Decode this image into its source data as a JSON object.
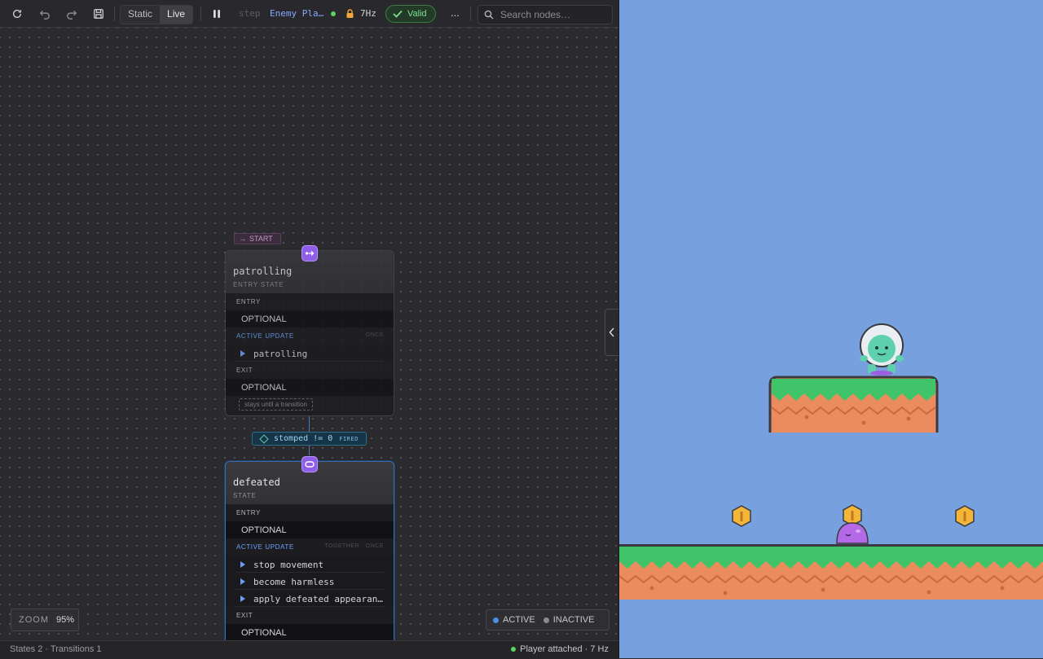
{
  "toolbar": {
    "mode_static": "Static",
    "mode_live": "Live",
    "step_label": "step",
    "machine_name": "Enemy Platformer",
    "rate": "7Hz",
    "valid": "Valid",
    "more": "...",
    "search_placeholder": "Search nodes…"
  },
  "start_badge": "START",
  "nodes": [
    {
      "name": "patrolling",
      "kind": "ENTRY STATE",
      "entry_label": "ENTRY",
      "entry_value": "OPTIONAL",
      "update_label": "ACTIVE UPDATE",
      "update_mode": "ONCE",
      "actions": [
        "patrolling"
      ],
      "exit_label": "EXIT",
      "exit_value": "OPTIONAL",
      "note": "stays until a transition"
    },
    {
      "name": "defeated",
      "kind": "STATE",
      "entry_label": "ENTRY",
      "entry_value": "OPTIONAL",
      "update_label": "ACTIVE UPDATE",
      "update_mode": "TOGETHER · ONCE",
      "actions": [
        "stop movement",
        "become harmless",
        "apply defeated appearance"
      ],
      "exit_label": "EXIT",
      "exit_value": "OPTIONAL"
    }
  ],
  "transition": {
    "condition": "stomped != 0",
    "status": "FIRED"
  },
  "zoom": {
    "label": "ZOOM",
    "value": "95%"
  },
  "legend": {
    "active": "ACTIVE",
    "inactive": "INACTIVE",
    "active_color": "#4a90e2",
    "inactive_color": "#8a8a90"
  },
  "status": {
    "left": "States 2 · Transitions 1",
    "right": "Player attached · 7 Hz"
  },
  "colors": {
    "accent": "#8e5ee8",
    "valid": "#7fe08a",
    "sky": "#76a0de",
    "grass": "#3fc46a",
    "dirt": "#ea8c5d"
  }
}
